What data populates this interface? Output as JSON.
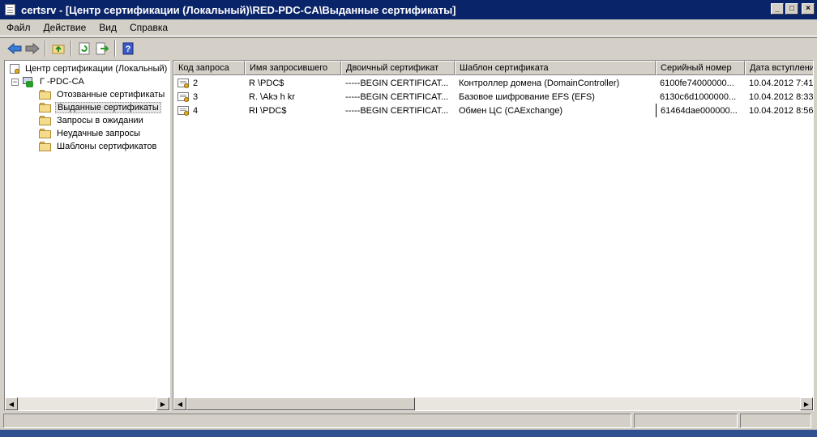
{
  "window": {
    "title": "certsrv - [Центр сертификации (Локальный)\\RED-PDC-CA\\Выданные сертификаты]",
    "controls": {
      "minimize": "_",
      "maximize": "□",
      "close": "×"
    }
  },
  "menu": [
    "Файл",
    "Действие",
    "Вид",
    "Справка"
  ],
  "toolbar_icons": [
    "back-arrow-icon",
    "forward-arrow-icon",
    "up-folder-icon",
    "refresh-icon",
    "export-list-icon",
    "help-icon"
  ],
  "tree": {
    "root": "Центр сертификации (Локальный)",
    "ca": "Г  -PDC-CA",
    "ca_expander": "−",
    "folders": [
      "Отозванные сертификаты",
      "Выданные сертификаты",
      "Запросы в ожидании",
      "Неудачные запросы",
      "Шаблоны сертификатов"
    ],
    "selected_index": 1
  },
  "table": {
    "columns": [
      "Код запроса",
      "Имя запросившего",
      "Двоичный сертификат",
      "Шаблон сертификата",
      "Серийный номер",
      "Дата вступления"
    ],
    "rows": [
      [
        "2",
        "R    \\PDC$",
        "-----BEGIN CERTIFICAT...",
        "Контроллер домена (DomainController)",
        "6100fe74000000...",
        "10.04.2012 7:41"
      ],
      [
        "3",
        "R.   \\Akэ  h    kr",
        "-----BEGIN CERTIFICAT...",
        "Базовое шифрование EFS (EFS)",
        "6130c6d1000000...",
        "10.04.2012 8:33"
      ],
      [
        "4",
        "RI   \\PDC$",
        "-----BEGIN CERTIFICAT...",
        "Обмен ЦС (CAExchange)",
        "61464dae000000...",
        "10.04.2012 8:56"
      ]
    ]
  },
  "scroll_icons": {
    "left": "◀",
    "right": "▶"
  }
}
